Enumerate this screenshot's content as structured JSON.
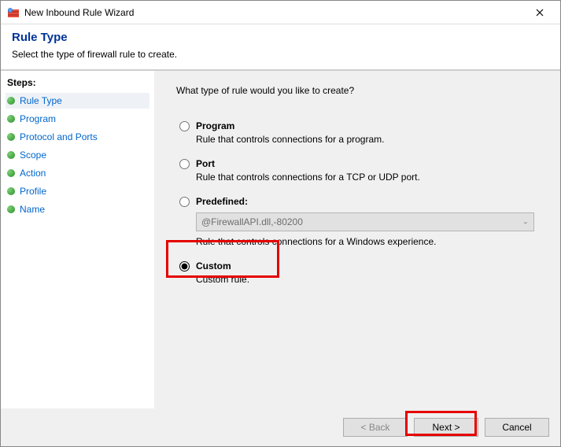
{
  "window": {
    "title": "New Inbound Rule Wizard"
  },
  "header": {
    "title": "Rule Type",
    "subtitle": "Select the type of firewall rule to create."
  },
  "sidebar": {
    "heading": "Steps:",
    "items": [
      {
        "label": "Rule Type"
      },
      {
        "label": "Program"
      },
      {
        "label": "Protocol and Ports"
      },
      {
        "label": "Scope"
      },
      {
        "label": "Action"
      },
      {
        "label": "Profile"
      },
      {
        "label": "Name"
      }
    ]
  },
  "content": {
    "question": "What type of rule would you like to create?",
    "options": {
      "program": {
        "title": "Program",
        "desc": "Rule that controls connections for a program."
      },
      "port": {
        "title": "Port",
        "desc": "Rule that controls connections for a TCP or UDP port."
      },
      "predefined": {
        "title": "Predefined:",
        "combo_value": "@FirewallAPI.dll,-80200",
        "desc": "Rule that controls connections for a Windows experience."
      },
      "custom": {
        "title": "Custom",
        "desc": "Custom rule."
      }
    }
  },
  "footer": {
    "back": "< Back",
    "next": "Next >",
    "cancel": "Cancel"
  }
}
